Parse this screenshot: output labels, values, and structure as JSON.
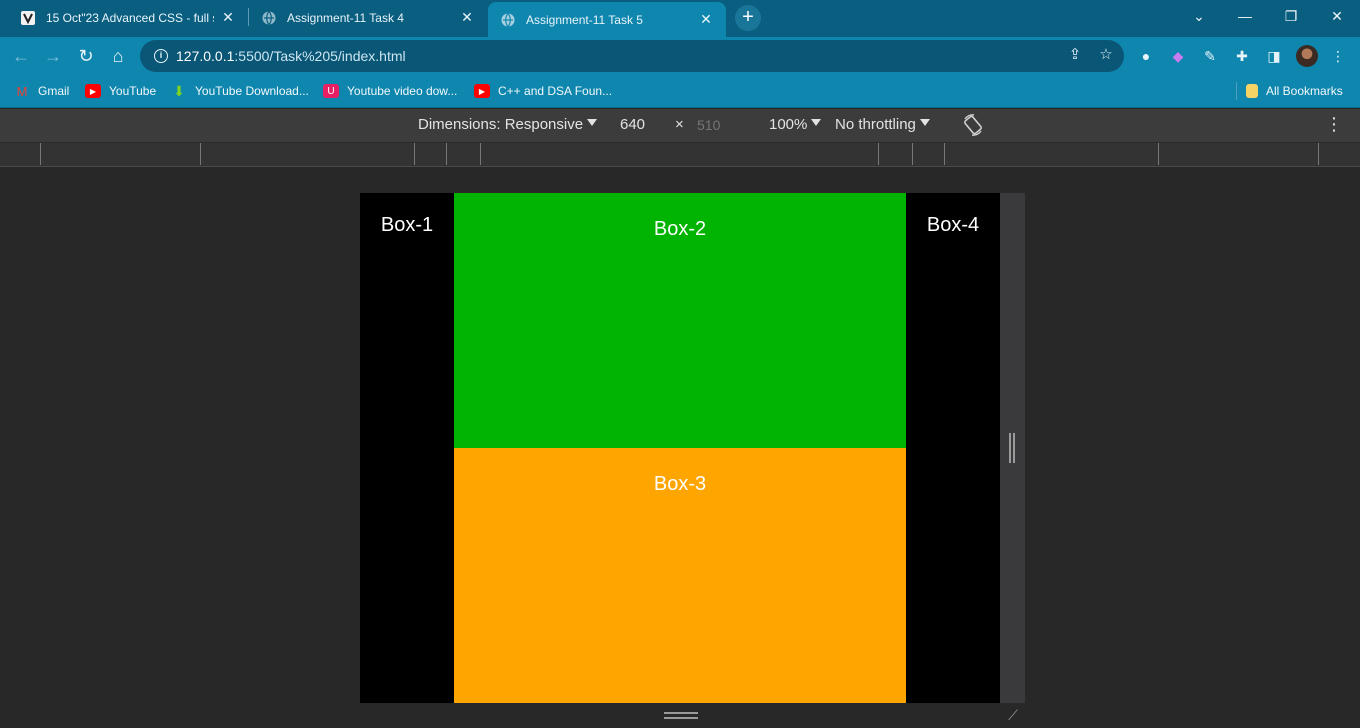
{
  "tabs": [
    {
      "title": "15 Oct\"23 Advanced CSS - full st",
      "icon": "video-favicon-icon",
      "active": false
    },
    {
      "title": "Assignment-11 Task 4",
      "icon": "globe-icon",
      "active": false
    },
    {
      "title": "Assignment-11 Task 5",
      "icon": "globe-icon",
      "active": true
    }
  ],
  "address": {
    "host": "127.0.0.1",
    "path": ":5500/Task%205/index.html"
  },
  "bookmarks": [
    {
      "label": "Gmail",
      "icon": "gmail-icon"
    },
    {
      "label": "YouTube",
      "icon": "youtube-icon"
    },
    {
      "label": "YouTube Download...",
      "icon": "download-icon"
    },
    {
      "label": "Youtube video dow...",
      "icon": "video-download-icon"
    },
    {
      "label": "C++ and DSA Foun...",
      "icon": "youtube-icon"
    },
    {
      "label": "All Bookmarks",
      "icon": "folder-icon"
    }
  ],
  "device_toolbar": {
    "dimensions_label": "Dimensions: Responsive",
    "width": "640",
    "times": "×",
    "height": "510",
    "zoom": "100%",
    "throttling": "No throttling"
  },
  "page": {
    "box1": "Box-1",
    "box2": "Box-2",
    "box3": "Box-3",
    "box4": "Box-4"
  },
  "colors": {
    "box2": "#01b401",
    "box3": "#ffa500",
    "side_boxes": "#000000"
  }
}
